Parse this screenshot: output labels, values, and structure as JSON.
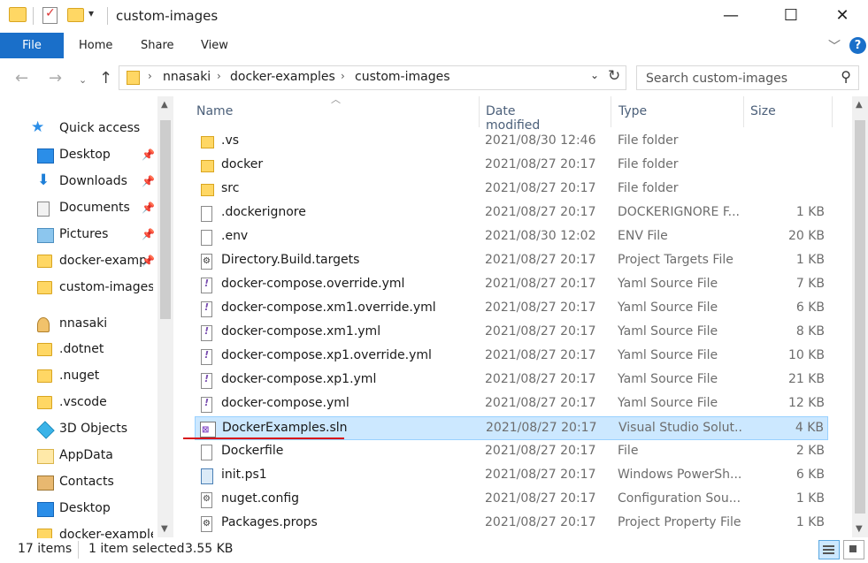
{
  "window": {
    "title": "custom-images",
    "controls": {
      "minimize": "—",
      "maximize": "☐",
      "close": "✕"
    }
  },
  "ribbon": {
    "tabs": [
      "File",
      "Home",
      "Share",
      "View"
    ],
    "help": "?"
  },
  "address": {
    "crumbs": [
      "nnasaki",
      "docker-examples",
      "custom-images"
    ],
    "search_placeholder": "Search custom-images"
  },
  "nav": {
    "items": [
      {
        "label": "Quick access",
        "icon": "star-icon"
      },
      {
        "label": "Desktop",
        "icon": "desktop-icon",
        "pinned": true
      },
      {
        "label": "Downloads",
        "icon": "download-icon",
        "pinned": true
      },
      {
        "label": "Documents",
        "icon": "documents-icon",
        "pinned": true
      },
      {
        "label": "Pictures",
        "icon": "pictures-icon",
        "pinned": true
      },
      {
        "label": "docker-examp",
        "icon": "folder-icon",
        "pinned": true
      },
      {
        "label": "custom-images",
        "icon": "folder-icon"
      },
      {
        "label": "nnasaki",
        "icon": "user-icon"
      },
      {
        "label": ".dotnet",
        "icon": "folder-icon"
      },
      {
        "label": ".nuget",
        "icon": "folder-icon"
      },
      {
        "label": ".vscode",
        "icon": "folder-icon"
      },
      {
        "label": "3D Objects",
        "icon": "objects-3d-icon"
      },
      {
        "label": "AppData",
        "icon": "appdata-folder-icon"
      },
      {
        "label": "Contacts",
        "icon": "contacts-icon"
      },
      {
        "label": "Desktop",
        "icon": "desktop-icon"
      },
      {
        "label": "docker-example",
        "icon": "folder-icon"
      }
    ]
  },
  "list": {
    "columns": {
      "name": "Name",
      "date": "Date modified",
      "type": "Type",
      "size": "Size"
    },
    "files": [
      {
        "name": ".vs",
        "date": "2021/08/30 12:46",
        "type": "File folder",
        "size": "",
        "icon": "folder"
      },
      {
        "name": "docker",
        "date": "2021/08/27 20:17",
        "type": "File folder",
        "size": "",
        "icon": "folder"
      },
      {
        "name": "src",
        "date": "2021/08/27 20:17",
        "type": "File folder",
        "size": "",
        "icon": "folder"
      },
      {
        "name": ".dockerignore",
        "date": "2021/08/27 20:17",
        "type": "DOCKERIGNORE F...",
        "size": "1 KB",
        "icon": "blank"
      },
      {
        "name": ".env",
        "date": "2021/08/30 12:02",
        "type": "ENV File",
        "size": "20 KB",
        "icon": "blank"
      },
      {
        "name": "Directory.Build.targets",
        "date": "2021/08/27 20:17",
        "type": "Project Targets File",
        "size": "1 KB",
        "icon": "target"
      },
      {
        "name": "docker-compose.override.yml",
        "date": "2021/08/27 20:17",
        "type": "Yaml Source File",
        "size": "7 KB",
        "icon": "yaml"
      },
      {
        "name": "docker-compose.xm1.override.yml",
        "date": "2021/08/27 20:17",
        "type": "Yaml Source File",
        "size": "6 KB",
        "icon": "yaml"
      },
      {
        "name": "docker-compose.xm1.yml",
        "date": "2021/08/27 20:17",
        "type": "Yaml Source File",
        "size": "8 KB",
        "icon": "yaml"
      },
      {
        "name": "docker-compose.xp1.override.yml",
        "date": "2021/08/27 20:17",
        "type": "Yaml Source File",
        "size": "10 KB",
        "icon": "yaml"
      },
      {
        "name": "docker-compose.xp1.yml",
        "date": "2021/08/27 20:17",
        "type": "Yaml Source File",
        "size": "21 KB",
        "icon": "yaml"
      },
      {
        "name": "docker-compose.yml",
        "date": "2021/08/27 20:17",
        "type": "Yaml Source File",
        "size": "12 KB",
        "icon": "yaml"
      },
      {
        "name": "DockerExamples.sln",
        "date": "2021/08/27 20:17",
        "type": "Visual Studio Solut...",
        "size": "4 KB",
        "icon": "sln",
        "selected": true
      },
      {
        "name": "Dockerfile",
        "date": "2021/08/27 20:17",
        "type": "File",
        "size": "2 KB",
        "icon": "blank"
      },
      {
        "name": "init.ps1",
        "date": "2021/08/27 20:17",
        "type": "Windows PowerSh...",
        "size": "6 KB",
        "icon": "ps"
      },
      {
        "name": "nuget.config",
        "date": "2021/08/27 20:17",
        "type": "Configuration Sou...",
        "size": "1 KB",
        "icon": "cfg"
      },
      {
        "name": "Packages.props",
        "date": "2021/08/27 20:17",
        "type": "Project Property File",
        "size": "1 KB",
        "icon": "target"
      }
    ]
  },
  "status": {
    "item_count": "17 items",
    "selection": "1 item selected",
    "selection_size": "3.55 KB"
  },
  "colors": {
    "accent": "#1a6fc9",
    "selection": "#cce8ff",
    "annotation": "#d8141c"
  }
}
